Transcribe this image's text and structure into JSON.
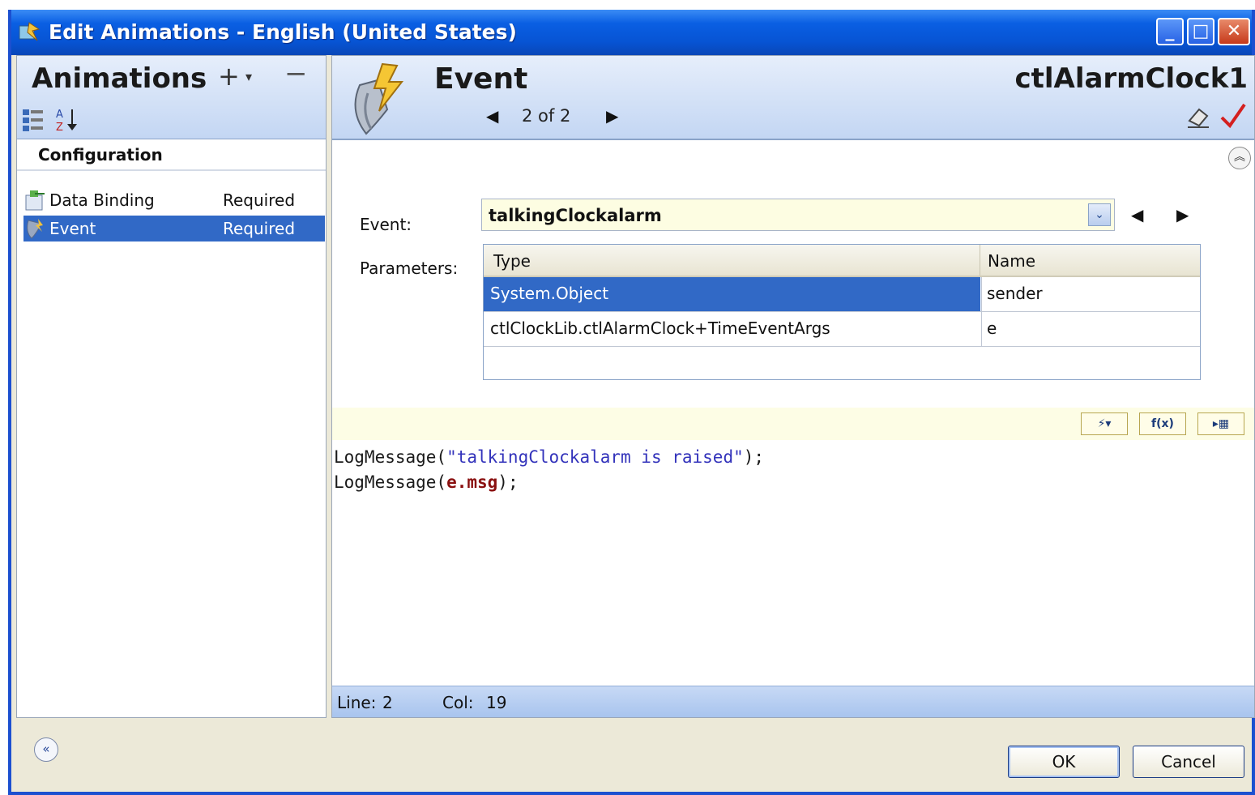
{
  "window": {
    "title": "Edit Animations - English (United States)",
    "controls": {
      "minimize": "_",
      "maximize": "□",
      "close": "✕"
    }
  },
  "left_panel": {
    "title": "Animations",
    "add_symbol": "+",
    "add_dropdown": "▾",
    "remove_symbol": "−",
    "section": "Configuration",
    "items": [
      {
        "name": "Data Binding",
        "status": "Required",
        "selected": false
      },
      {
        "name": "Event",
        "status": "Required",
        "selected": true
      }
    ]
  },
  "right_panel": {
    "title": "Event",
    "object_name": "ctlAlarmClock1",
    "nav": "2 of 2",
    "prev_symbol": "◀",
    "next_symbol": "▶",
    "collapse_symbol": "︽",
    "event_label": "Event:",
    "event_value": "talkingClockalarm",
    "dropdown_symbol": "⌄",
    "parameters_label": "Parameters:",
    "parameters": {
      "headers": [
        "Type",
        "Name"
      ],
      "rows": [
        {
          "type": "System.Object",
          "name": "sender",
          "selected": true
        },
        {
          "type": "ctlClockLib.ctlAlarmClock+TimeEventArgs",
          "name": "e",
          "selected": false
        }
      ]
    },
    "editor_buttons": [
      "⚡▾",
      "f(x)",
      "▸▦"
    ],
    "code_lines": [
      {
        "prefix": "LogMessage(",
        "arg": "\"talkingClockalarm is raised\"",
        "suffix": ");"
      },
      {
        "prefix": "LogMessage(",
        "arg": "e.msg",
        "suffix": ");"
      }
    ],
    "status": {
      "line_label": "Line:",
      "line": "2",
      "col_label": "Col:",
      "col": "19"
    }
  },
  "footer": {
    "collapse_symbol": "«",
    "ok": "OK",
    "cancel": "Cancel"
  },
  "colors": {
    "titlebar": "#0754d4",
    "selection": "#3169c6",
    "header_gradient": "#c3d6f3",
    "editor_bar": "#fdfde5",
    "string": "#3333bb",
    "variable": "#8a1010"
  }
}
